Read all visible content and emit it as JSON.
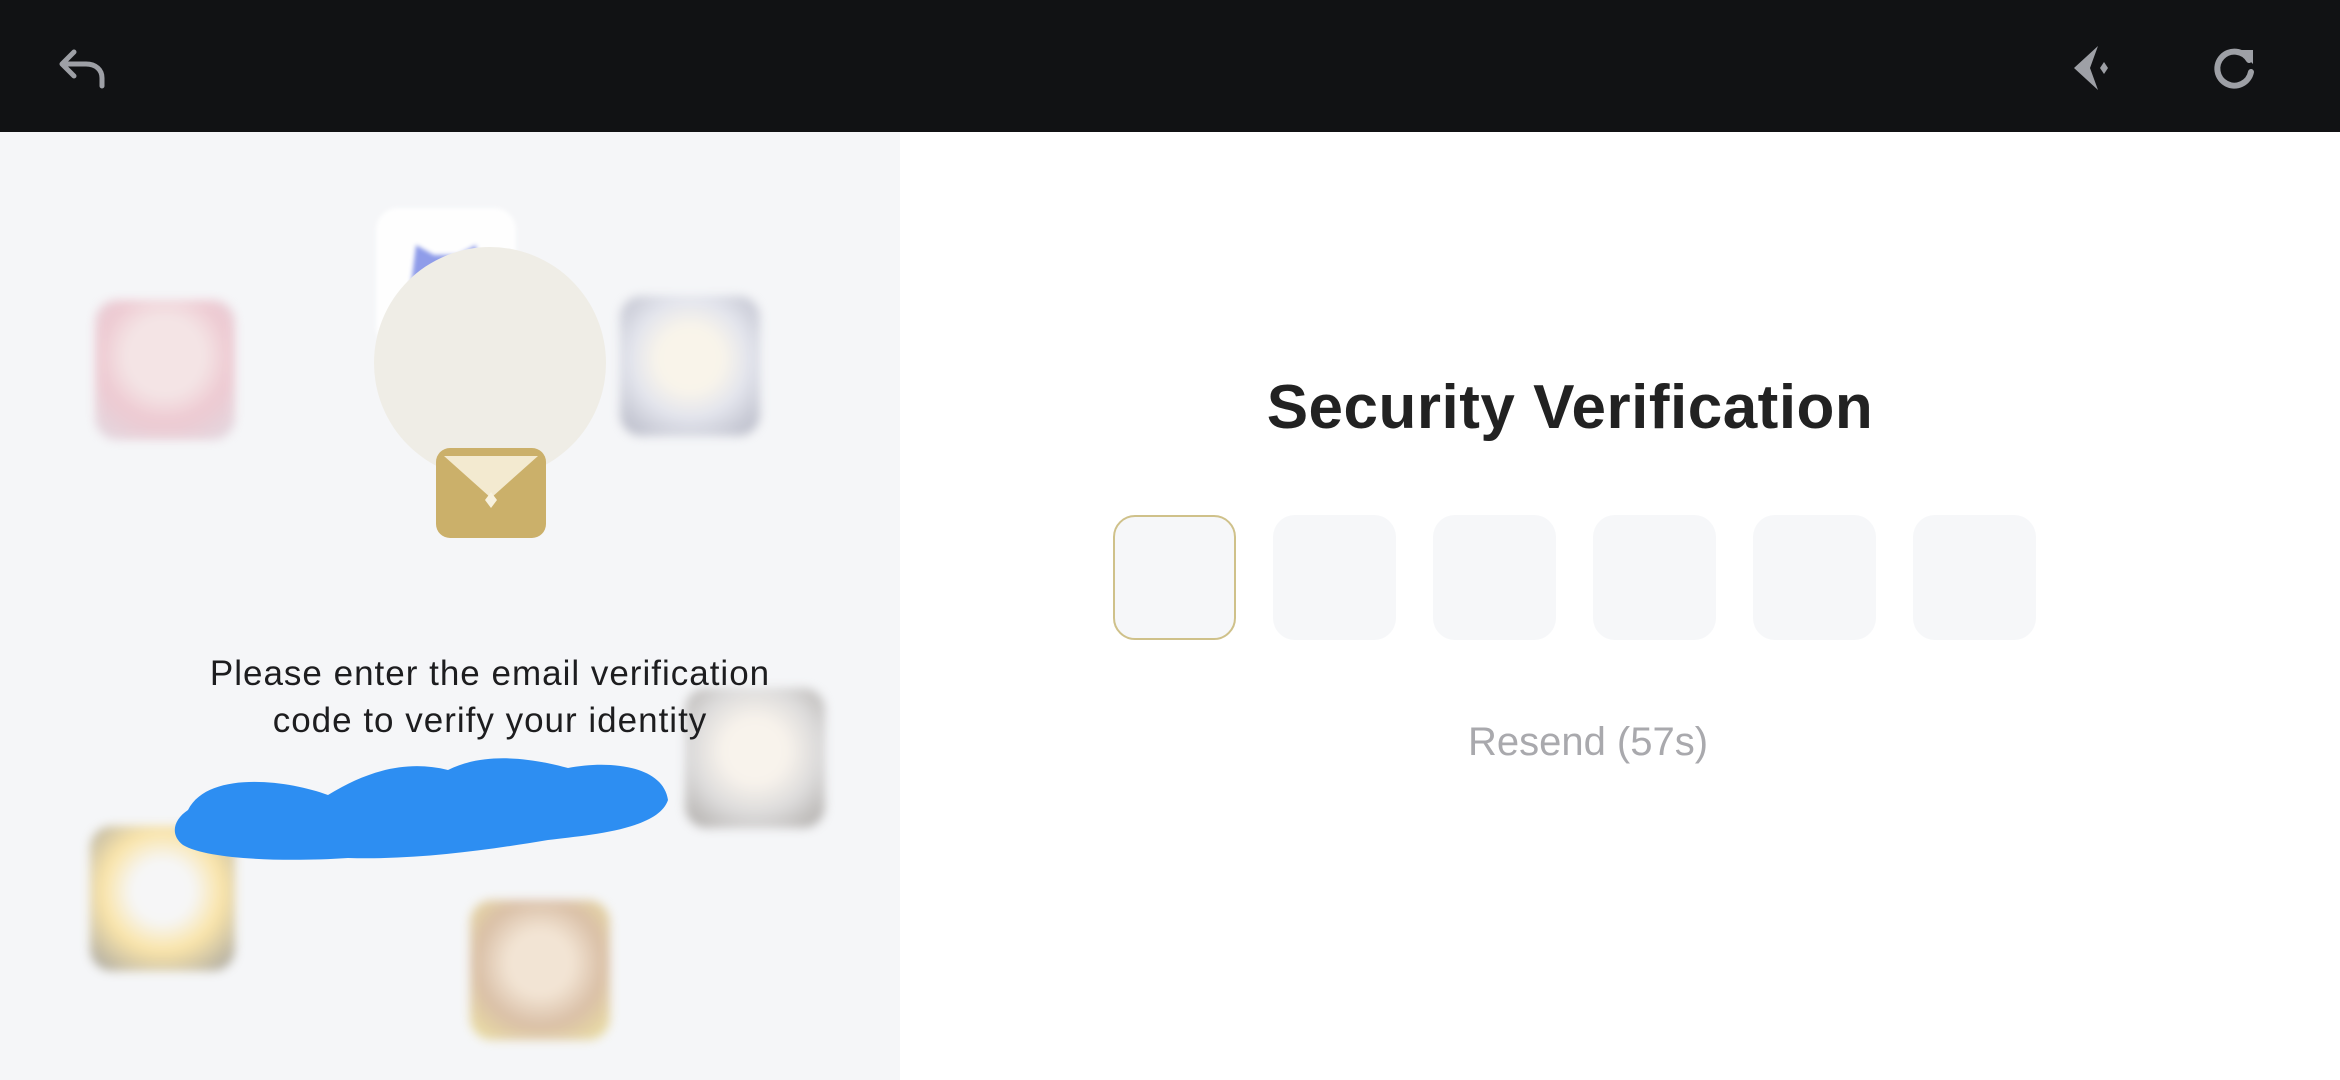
{
  "topbar": {
    "back_icon": "back-arrow-icon",
    "assist_icon": "sparkle-icon",
    "refresh_icon": "refresh-icon"
  },
  "left_panel": {
    "instructions_line1": "Please enter the email verification",
    "instructions_line2": "code to verify your identity",
    "mail_icon": "envelope-icon",
    "discord_icon": "discord-icon",
    "accent_color": "#cbb06a"
  },
  "verification": {
    "title": "Security Verification",
    "code_digits": [
      "",
      "",
      "",
      "",
      "",
      ""
    ],
    "resend_label": "Resend (57s)",
    "active_border_color": "#cfc18a"
  }
}
